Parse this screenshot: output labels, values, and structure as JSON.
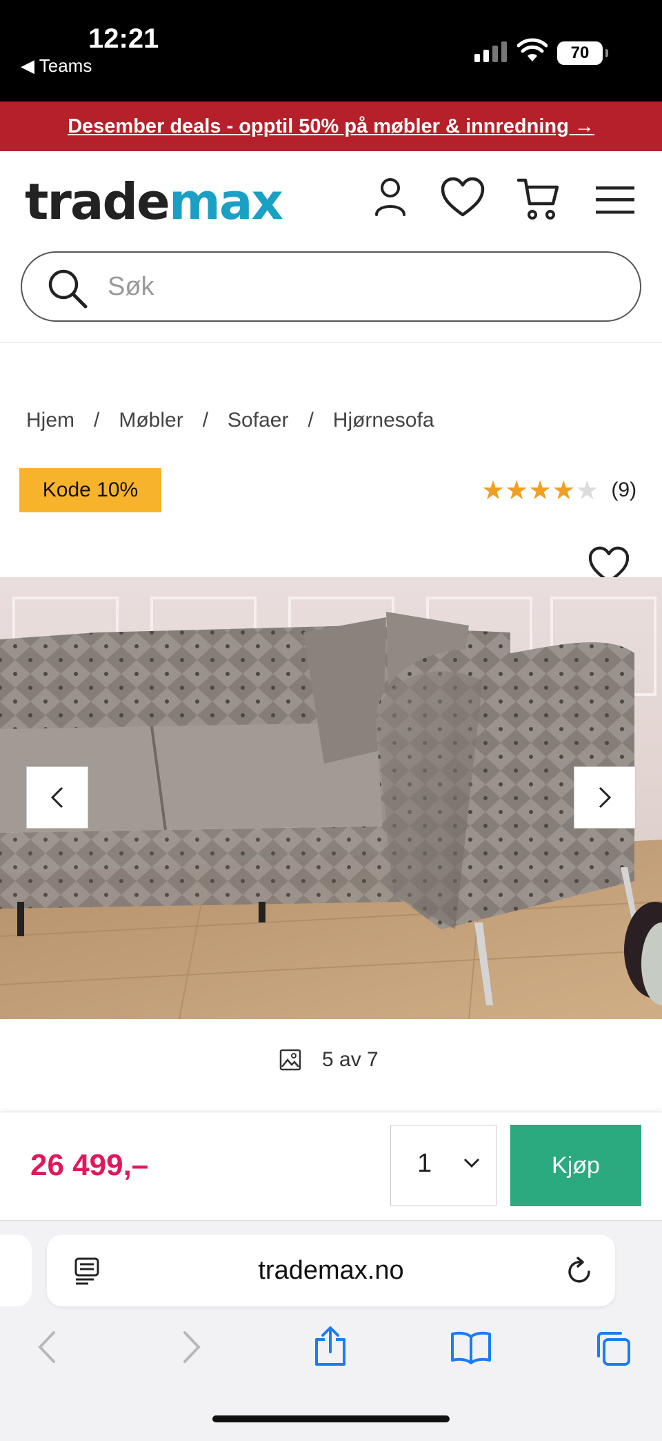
{
  "status_bar": {
    "time": "12:21",
    "back_app": "◀ Teams",
    "battery": "70"
  },
  "promo": {
    "text": "Desember deals - opptil 50% på møbler & innredning →"
  },
  "header": {
    "logo_part1": "trade",
    "logo_part2": "max",
    "brand_color": "#1aa0c4",
    "icons": [
      "account-icon",
      "heart-icon",
      "cart-icon",
      "menu-icon"
    ]
  },
  "search": {
    "placeholder": "Søk"
  },
  "breadcrumb": {
    "items": [
      "Hjem",
      "Møbler",
      "Sofaer",
      "Hjørnesofa"
    ],
    "separator": "/"
  },
  "product": {
    "badge": "Kode 10%",
    "badge_color": "#f7b32b",
    "rating_stars": 4,
    "rating_max": 5,
    "rating_count": "(9)",
    "image_counter": "5 av 7",
    "price": "26 499,–",
    "price_color": "#e0195a",
    "quantity": "1",
    "buy_label": "Kjøp",
    "buy_color": "#2aaa7e"
  },
  "browser": {
    "url": "trademax.no"
  }
}
